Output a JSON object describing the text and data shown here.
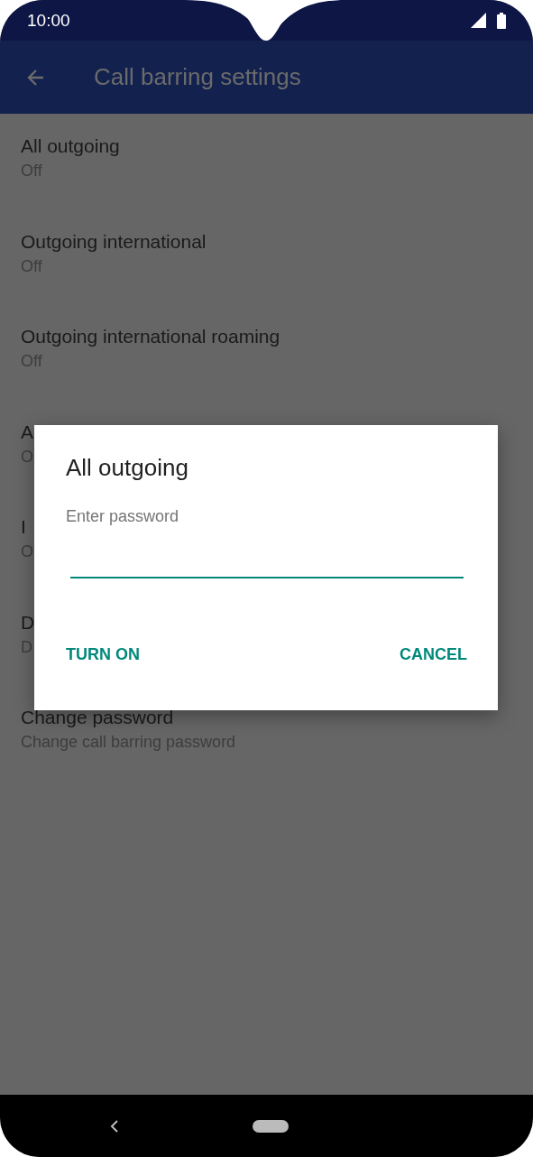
{
  "status_bar": {
    "time": "10:00"
  },
  "app_bar": {
    "title": "Call barring settings"
  },
  "settings": [
    {
      "title": "All outgoing",
      "summary": "Off"
    },
    {
      "title": "Outgoing international",
      "summary": "Off"
    },
    {
      "title": "Outgoing international roaming",
      "summary": "Off"
    },
    {
      "title": "A",
      "summary": "O"
    },
    {
      "title": "I",
      "summary": "O"
    },
    {
      "title": "D",
      "summary": "D"
    },
    {
      "title": "Change password",
      "summary": "Change call barring password"
    }
  ],
  "dialog": {
    "title": "All outgoing",
    "message": "Enter password",
    "buttons": [
      "TURN ON",
      "CANCEL"
    ]
  }
}
